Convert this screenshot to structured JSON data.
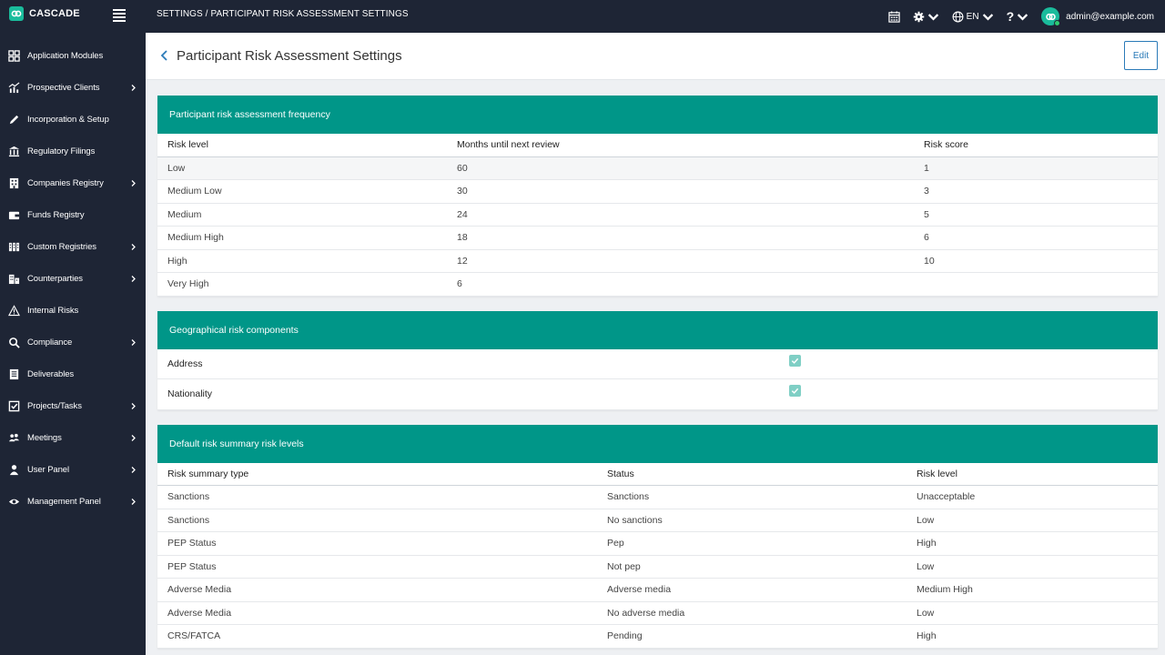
{
  "app": {
    "name": "CASCADE",
    "breadcrumb": "SETTINGS  /  PARTICIPANT RISK ASSESSMENT SETTINGS"
  },
  "topbar": {
    "language": "EN",
    "user_email": "admin@example.com"
  },
  "sidebar": {
    "items": [
      {
        "label": "Application Modules",
        "icon": "grid-icon",
        "has_children": false
      },
      {
        "label": "Prospective Clients",
        "icon": "chart-icon",
        "has_children": true
      },
      {
        "label": "Incorporation & Setup",
        "icon": "pen-icon",
        "has_children": false
      },
      {
        "label": "Regulatory Filings",
        "icon": "bank-icon",
        "has_children": false
      },
      {
        "label": "Companies Registry",
        "icon": "building-icon",
        "has_children": true
      },
      {
        "label": "Funds Registry",
        "icon": "wallet-icon",
        "has_children": false
      },
      {
        "label": "Custom Registries",
        "icon": "columns-icon",
        "has_children": true
      },
      {
        "label": "Counterparties",
        "icon": "buildings-icon",
        "has_children": true
      },
      {
        "label": "Internal Risks",
        "icon": "warning-icon",
        "has_children": false
      },
      {
        "label": "Compliance",
        "icon": "search-icon",
        "has_children": true
      },
      {
        "label": "Deliverables",
        "icon": "list-icon",
        "has_children": false
      },
      {
        "label": "Projects/Tasks",
        "icon": "checkbox-icon",
        "has_children": true
      },
      {
        "label": "Meetings",
        "icon": "people-icon",
        "has_children": true
      },
      {
        "label": "User Panel",
        "icon": "user-icon",
        "has_children": true
      },
      {
        "label": "Management Panel",
        "icon": "eye-icon",
        "has_children": true
      }
    ]
  },
  "page": {
    "title": "Participant Risk Assessment Settings",
    "edit_label": "Edit"
  },
  "frequency": {
    "title": "Participant risk assessment frequency",
    "columns": [
      "Risk level",
      "Months until next review",
      "Risk score"
    ],
    "rows": [
      [
        "Low",
        "60",
        "1"
      ],
      [
        "Medium Low",
        "30",
        "3"
      ],
      [
        "Medium",
        "24",
        "5"
      ],
      [
        "Medium High",
        "18",
        "6"
      ],
      [
        "High",
        "12",
        "10"
      ],
      [
        "Very High",
        "6",
        ""
      ]
    ]
  },
  "geo": {
    "title": "Geographical risk components",
    "rows": [
      {
        "label": "Address",
        "checked": true
      },
      {
        "label": "Nationality",
        "checked": true
      }
    ]
  },
  "summary": {
    "title": "Default risk summary risk levels",
    "columns": [
      "Risk summary type",
      "Status",
      "Risk level"
    ],
    "rows": [
      [
        "Sanctions",
        "Sanctions",
        "Unacceptable"
      ],
      [
        "Sanctions",
        "No sanctions",
        "Low"
      ],
      [
        "PEP Status",
        "Pep",
        "High"
      ],
      [
        "PEP Status",
        "Not pep",
        "Low"
      ],
      [
        "Adverse Media",
        "Adverse media",
        "Medium High"
      ],
      [
        "Adverse Media",
        "No adverse media",
        "Low"
      ],
      [
        "CRS/FATCA",
        "Pending",
        "High"
      ]
    ]
  },
  "colors": {
    "topbar": "#1e2535",
    "accent": "#009688",
    "brand": "#1abc9c",
    "link": "#2a7ab8"
  }
}
